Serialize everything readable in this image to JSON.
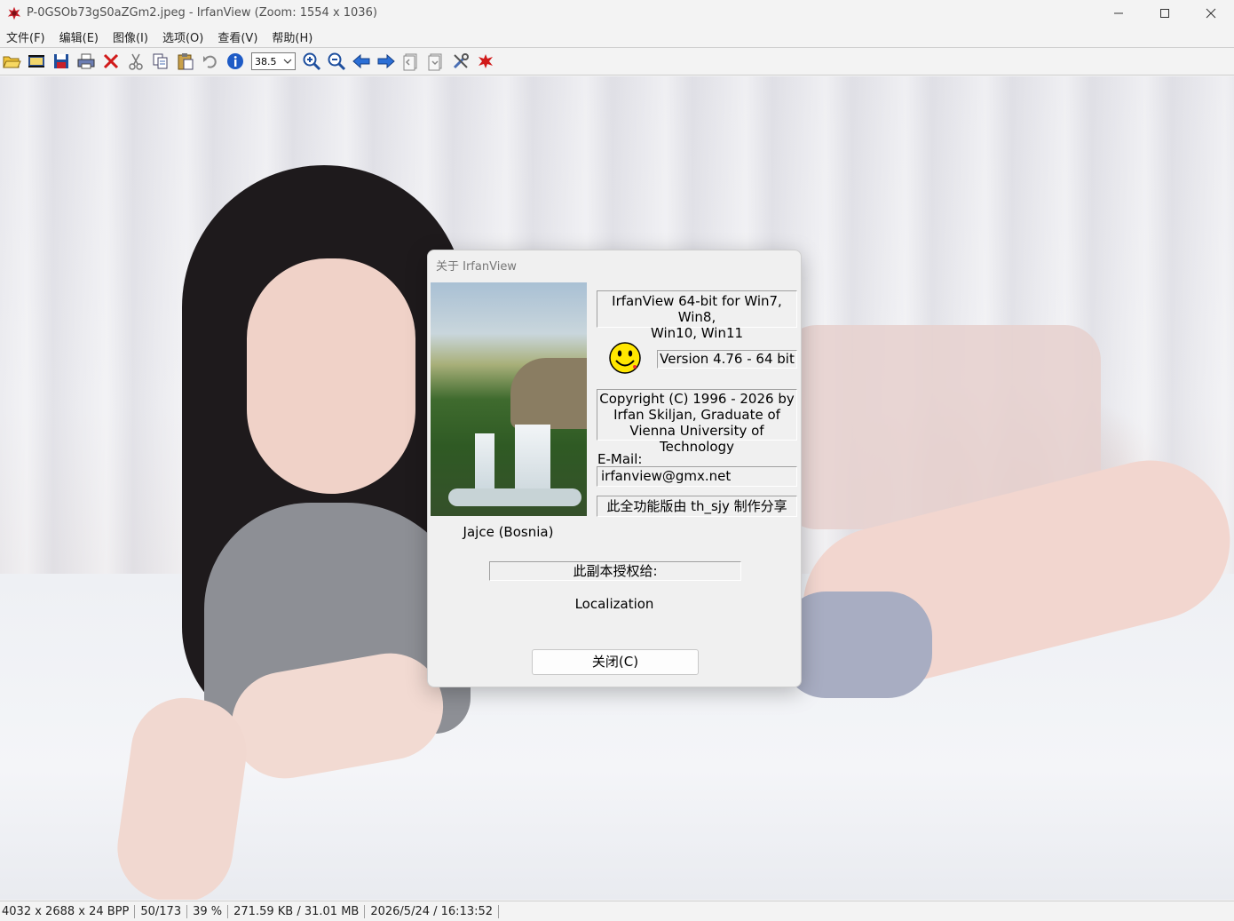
{
  "window": {
    "title": "P-0GSOb73gS0aZGm2.jpeg - IrfanView (Zoom: 1554 x 1036)"
  },
  "menu": {
    "items": [
      "文件(F)",
      "编辑(E)",
      "图像(I)",
      "选项(O)",
      "查看(V)",
      "帮助(H)"
    ]
  },
  "toolbar": {
    "zoom_value": "38.5",
    "icons": [
      "open-icon",
      "thumbnails-icon",
      "save-icon",
      "print-icon",
      "delete-icon",
      "cut-icon",
      "copy-icon",
      "paste-icon",
      "undo-icon",
      "info-icon",
      "zoom-in-icon",
      "zoom-out-icon",
      "previous-icon",
      "next-icon",
      "first-page-icon",
      "last-page-icon",
      "settings-icon",
      "irfanview-logo-icon"
    ]
  },
  "status": {
    "dimensions": "4032 x 2688 x 24 BPP",
    "index": "50/173",
    "zoom": "39 %",
    "size": "271.59 KB / 31.01 MB",
    "datetime": "2026/5/24 / 16:13:52"
  },
  "about": {
    "title": "关于  IrfanView",
    "product_line1": "IrfanView 64-bit for Win7, Win8,",
    "product_line2": "Win10, Win11",
    "version": "Version 4.76 - 64 bit",
    "copyright_line1": "Copyright (C) 1996 - 2026 by",
    "copyright_line2": "Irfan Skiljan, Graduate of",
    "copyright_line3": "Vienna University of Technology",
    "email_label": "E-Mail:",
    "email": "irfanview@gmx.net",
    "share_note": "此全功能版由 th_sjy 制作分享",
    "photo_caption": "Jajce (Bosnia)",
    "license_label": "此副本授权给:",
    "localization": "Localization",
    "close_label": "关闭(C)"
  }
}
